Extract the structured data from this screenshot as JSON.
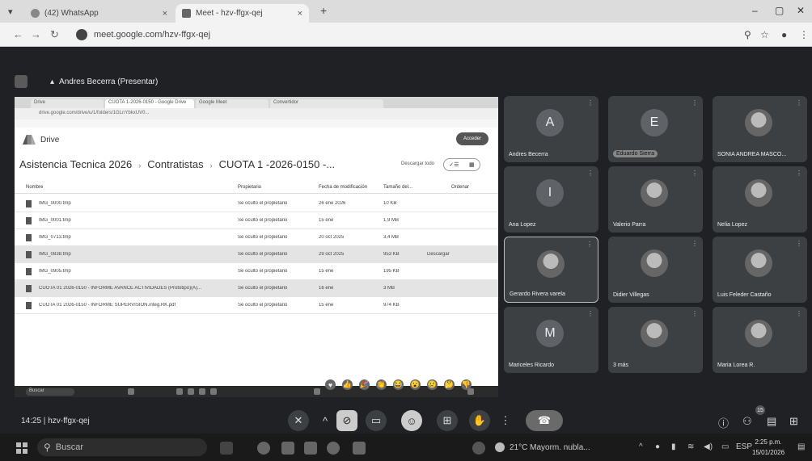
{
  "browser": {
    "tabs": [
      {
        "label": "(42) WhatsApp",
        "close": "×"
      },
      {
        "label": "Meet - hzv-ffgx-qej",
        "close": "×"
      }
    ],
    "new_tab": "+",
    "url": "meet.google.com/hzv-ffgx-qej"
  },
  "meet": {
    "presenter_label": "Andres Becerra (Presentar)",
    "shared_screen": {
      "inner_tabs": [
        "Drive",
        "CUOTA 1-2026-0150 - Google Drive",
        "Google Meet",
        "Convertidor"
      ],
      "inner_url": "drive.google.com/drive/u/1/folders/1GLnYbkxUV0...",
      "drive_title": "Drive",
      "access_button": "Acceder",
      "breadcrumb": [
        "Asistencia Tecnica 2026",
        "Contratistas",
        "CUOTA 1 -2026-0150 -..."
      ],
      "download_all": "Descargar todo",
      "columns": [
        "Nombre",
        "Propietario",
        "Fecha de modificación",
        "Tamaño del..."
      ],
      "sort_label": "Ordenar",
      "files": [
        {
          "name": "IMG_0000.tmp",
          "owner": "Se oculto el propietario",
          "date": "26 ene 2026",
          "size": "10 KB",
          "selected": false
        },
        {
          "name": "IMG_0001.tmp",
          "owner": "Se oculto el propietario",
          "date": "15 ene",
          "size": "1,9 MB",
          "selected": false
        },
        {
          "name": "IMG_0713.tmp",
          "owner": "Se oculto el propietario",
          "date": "20 oct 2025",
          "size": "3,4 MB",
          "selected": false
        },
        {
          "name": "IMG_0838.tmp",
          "owner": "Se oculto el propietario",
          "date": "29 oct 2025",
          "size": "953 KB",
          "selected": true,
          "action": "Descargar"
        },
        {
          "name": "IMG_0905.tmp",
          "owner": "Se oculto el propietario",
          "date": "15 ene",
          "size": "195 KB",
          "selected": false
        },
        {
          "name": "CUOTA 01 2026-0150 - INFORME AVANCE ACTIVIDADES (Prototipo)(A)...",
          "owner": "Se oculto el propietario",
          "date": "16 ene",
          "size": "3 MB",
          "selected": true
        },
        {
          "name": "CUOTA 01 2026-0150 - INFORME SUPERVISION.integ.RK.pdf",
          "owner": "Se oculto el propietario",
          "date": "15 ene",
          "size": "974 KB",
          "selected": false
        }
      ],
      "taskbar_search": "Buscar"
    },
    "participants": [
      {
        "name": "Andres Becerra",
        "initial": "A",
        "type": "letter"
      },
      {
        "name": "Eduardo Sierra",
        "initial": "E",
        "type": "letter-chip"
      },
      {
        "name": "SONIA ANDREA MASCO...",
        "initial": "",
        "type": "photo"
      },
      {
        "name": "Ana Lopez",
        "initial": "I",
        "type": "letter"
      },
      {
        "name": "Valerio Parra",
        "initial": "",
        "type": "photo"
      },
      {
        "name": "Nelia Lopez",
        "initial": "",
        "type": "photo"
      },
      {
        "name": "Gerardo Rivera varela",
        "initial": "",
        "type": "photo",
        "active": true
      },
      {
        "name": "Didier Villegas",
        "initial": "",
        "type": "photo"
      },
      {
        "name": "Luis Feleder Castaño",
        "initial": "",
        "type": "photo"
      },
      {
        "name": "Mariceles Ricardo",
        "initial": "M",
        "type": "letter"
      },
      {
        "name": "3 más",
        "initial": "",
        "type": "photo"
      },
      {
        "name": "Maria Lorea R.",
        "initial": "",
        "type": "photo"
      }
    ],
    "reactions": [
      "♥",
      "👍",
      "🎉",
      "👏",
      "😂",
      "😮",
      "😢",
      "🤔",
      "👎"
    ],
    "meeting_time": "14:25",
    "meeting_code": "hzv-ffgx-qej",
    "participant_count": "15"
  },
  "taskbar": {
    "search_placeholder": "Buscar",
    "weather": "21°C  Mayorm. nubla...",
    "time": "2:25 p.m.",
    "date": "15/01/2026"
  }
}
